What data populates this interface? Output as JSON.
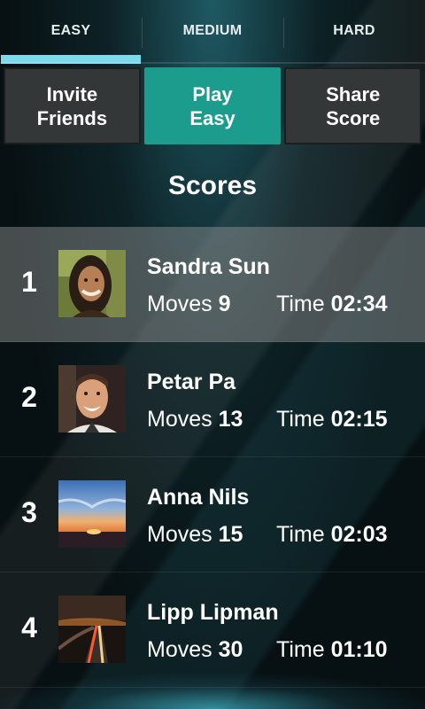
{
  "tabs": [
    {
      "label": "EASY",
      "active": true
    },
    {
      "label": "MEDIUM",
      "active": false
    },
    {
      "label": "HARD",
      "active": false
    }
  ],
  "actions": {
    "invite": [
      "Invite",
      "Friends"
    ],
    "play": [
      "Play",
      "Easy"
    ],
    "share": [
      "Share",
      "Score"
    ]
  },
  "section_title": "Scores",
  "stat_labels": {
    "moves": "Moves",
    "time": "Time"
  },
  "scores": [
    {
      "rank": "1",
      "name": "Sandra Sun",
      "moves": "9",
      "time": "02:34",
      "avatar": "portrait-woman",
      "highlight": true
    },
    {
      "rank": "2",
      "name": "Petar Pa",
      "moves": "13",
      "time": "02:15",
      "avatar": "portrait-man",
      "highlight": false
    },
    {
      "rank": "3",
      "name": "Anna Nils",
      "moves": "15",
      "time": "02:03",
      "avatar": "sunset-landscape",
      "highlight": false
    },
    {
      "rank": "4",
      "name": "Lipp Lipman",
      "moves": "30",
      "time": "01:10",
      "avatar": "night-highway",
      "highlight": false
    }
  ],
  "colors": {
    "accent_teal": "#1b9c8d",
    "tab_indicator": "#7fd9ec",
    "highlight_row": "#7a7a7a"
  }
}
